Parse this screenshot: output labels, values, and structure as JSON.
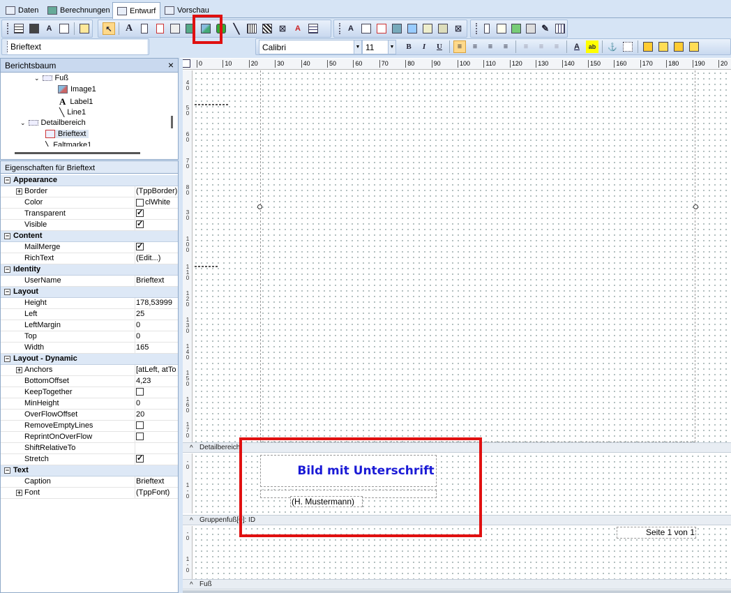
{
  "tabs": [
    {
      "label": "Daten"
    },
    {
      "label": "Berechnungen"
    },
    {
      "label": "Entwurf"
    },
    {
      "label": "Vorschau"
    }
  ],
  "toolbar": {
    "component_name": "Brieftext"
  },
  "format": {
    "font": "Calibri",
    "size": "11"
  },
  "tree": {
    "title": "Berichtsbaum",
    "close": "×",
    "items": [
      {
        "label": "Fuß"
      },
      {
        "label": "Image1"
      },
      {
        "label": "Label1"
      },
      {
        "label": "Line1"
      },
      {
        "label": "Detailbereich"
      },
      {
        "label": "Brieftext"
      },
      {
        "label": "Faltmarke1"
      }
    ]
  },
  "props": {
    "title": "Eigenschaften für Brieftext",
    "categories": [
      {
        "name": "Appearance",
        "rows": [
          {
            "name": "Border",
            "value": "(TppBorder)"
          },
          {
            "name": "Color",
            "value": "clWhite"
          },
          {
            "name": "Transparent",
            "value": ""
          },
          {
            "name": "Visible",
            "value": ""
          }
        ]
      },
      {
        "name": "Content",
        "rows": [
          {
            "name": "MailMerge",
            "value": ""
          },
          {
            "name": "RichText",
            "value": "(Edit...)"
          }
        ]
      },
      {
        "name": "Identity",
        "rows": [
          {
            "name": "UserName",
            "value": "Brieftext"
          }
        ]
      },
      {
        "name": "Layout",
        "rows": [
          {
            "name": "Height",
            "value": "178,53999"
          },
          {
            "name": "Left",
            "value": "25"
          },
          {
            "name": "LeftMargin",
            "value": "0"
          },
          {
            "name": "Top",
            "value": "0"
          },
          {
            "name": "Width",
            "value": "165"
          }
        ]
      },
      {
        "name": "Layout - Dynamic",
        "rows": [
          {
            "name": "Anchors",
            "value": "[atLeft, atTo"
          },
          {
            "name": "BottomOffset",
            "value": "4,23"
          },
          {
            "name": "KeepTogether",
            "value": ""
          },
          {
            "name": "MinHeight",
            "value": "0"
          },
          {
            "name": "OverFlowOffset",
            "value": "20"
          },
          {
            "name": "RemoveEmptyLines",
            "value": ""
          },
          {
            "name": "ReprintOnOverFlow",
            "value": ""
          },
          {
            "name": "ShiftRelativeTo",
            "value": ""
          },
          {
            "name": "Stretch",
            "value": ""
          }
        ]
      },
      {
        "name": "Text",
        "rows": [
          {
            "name": "Caption",
            "value": "Brieftext"
          },
          {
            "name": "Font",
            "value": "(TppFont)"
          }
        ]
      }
    ]
  },
  "ruler": [
    "0",
    "10",
    "20",
    "30",
    "40",
    "50",
    "60",
    "70",
    "80",
    "90",
    "100",
    "110",
    "120",
    "130",
    "140",
    "150",
    "160",
    "170",
    "180",
    "190",
    "20"
  ],
  "bands": {
    "detail": "Detailbereich",
    "groupfooter": "Gruppenfuß[0]: ID",
    "footer": "Fuß"
  },
  "design": {
    "caption": "Bild mit Unterschrift",
    "signature": "(H. Mustermann)",
    "pageinfo": "Seite 1 von 1",
    "caption_color": "#1a1ad6"
  },
  "highlight_color": "#e01010"
}
